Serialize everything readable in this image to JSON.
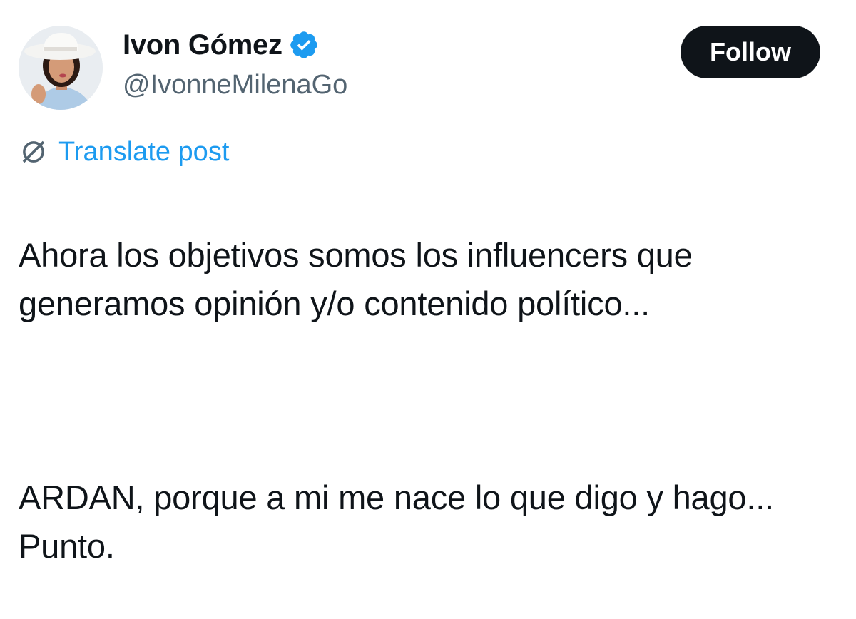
{
  "author": {
    "display_name": "Ivon Gómez",
    "handle": "@IvonneMilenaGo",
    "verified_icon": "verified-badge-icon",
    "avatar_icon": "profile-photo"
  },
  "actions": {
    "follow_label": "Follow"
  },
  "translate": {
    "icon": "globe-slash-icon",
    "label": "Translate post"
  },
  "post": {
    "paragraphs": [
      "Ahora los objetivos somos los influencers que generamos opinión y/o contenido político...",
      "ARDAN, porque a mi me nace lo que digo y hago... Punto."
    ]
  },
  "colors": {
    "accent_blue": "#1d9bf0",
    "text_primary": "#0f1419",
    "text_secondary": "#536471",
    "button_bg": "#0f1419"
  }
}
